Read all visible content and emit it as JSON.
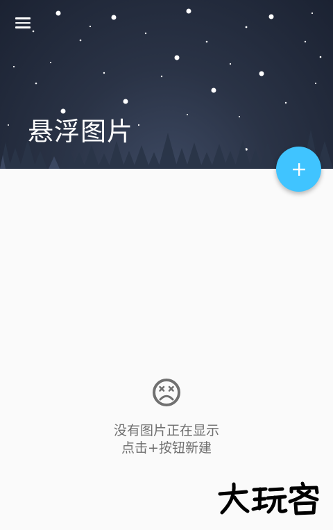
{
  "app": {
    "title": "悬浮图片"
  },
  "header": {
    "menu_icon": "hamburger-menu-icon"
  },
  "fab": {
    "icon": "plus-icon",
    "color": "#40c4ff"
  },
  "empty_state": {
    "icon": "dead-face-icon",
    "line1": "没有图片正在显示",
    "line2": "点击+按钮新建"
  },
  "watermark": {
    "text": "大玩客"
  },
  "colors": {
    "header_dark": "#1b2232",
    "accent": "#40c4ff",
    "background": "#fafafa",
    "secondary_text": "#6f6f6f"
  }
}
